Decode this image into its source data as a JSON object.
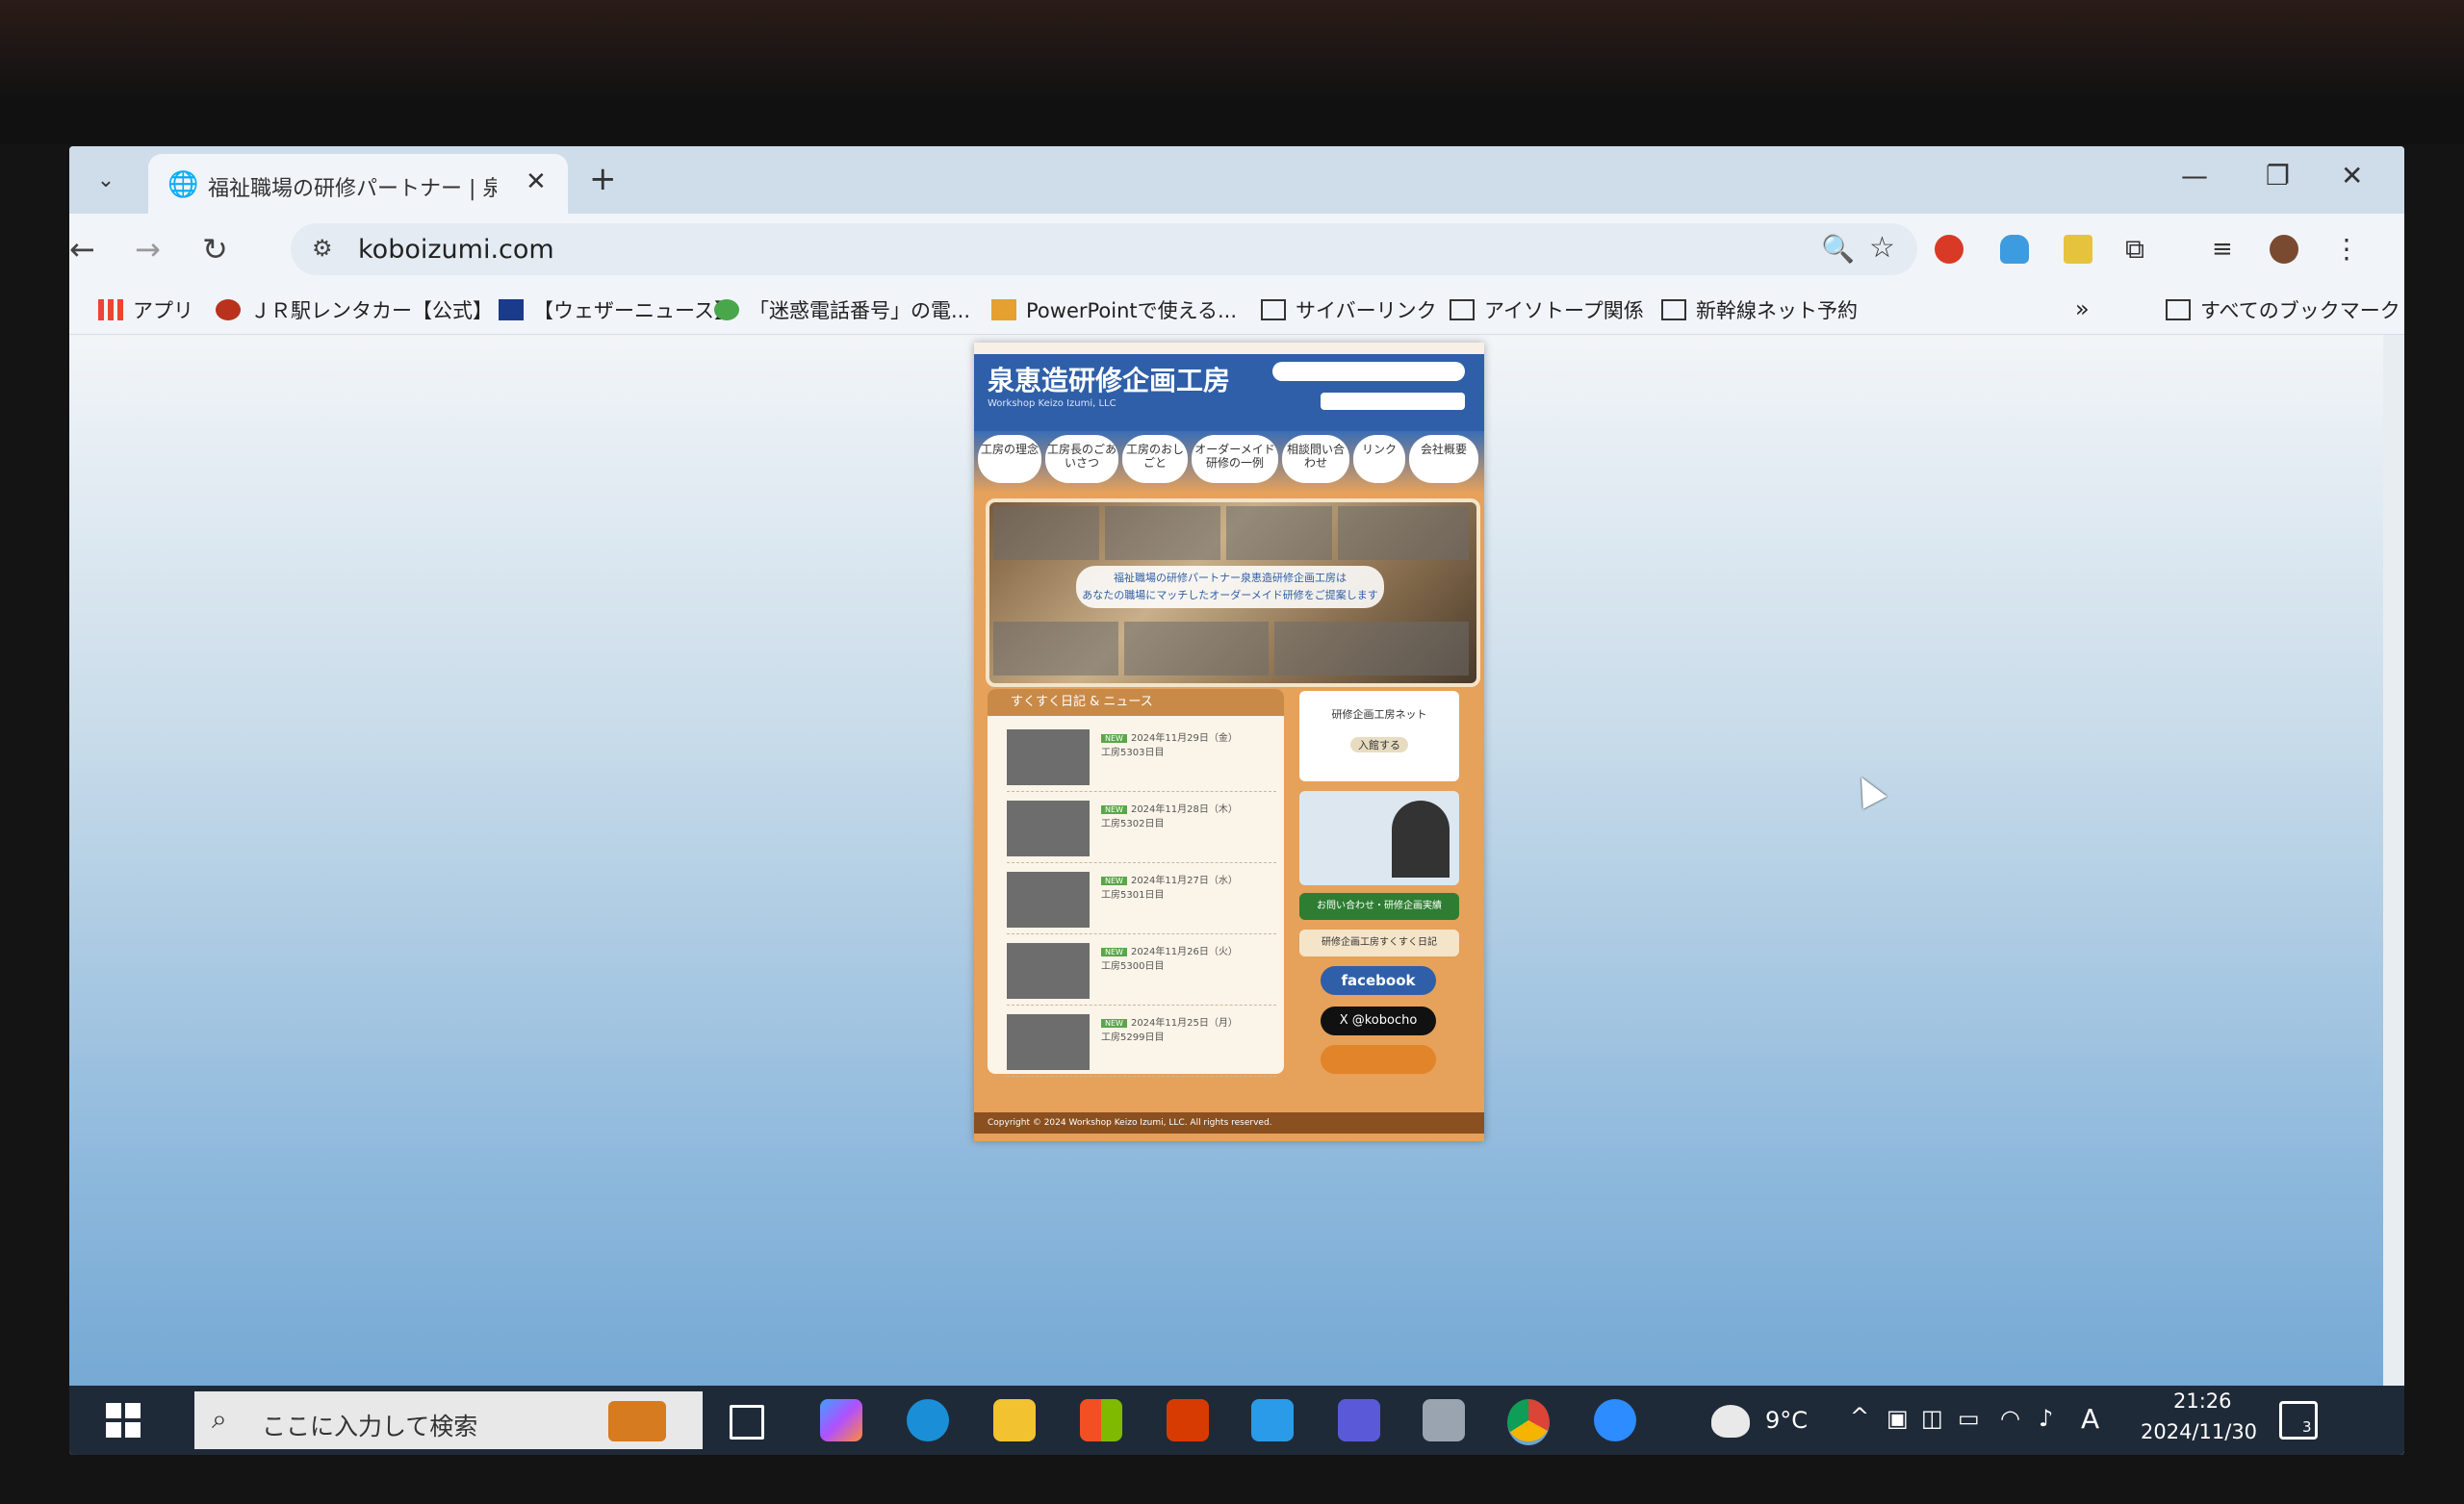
{
  "browser": {
    "tab_title": "福祉職場の研修パートナー | 泉恵",
    "url": "koboizumi.com"
  },
  "bookmarks": [
    {
      "label": "アプリ",
      "icon": "apps-grid-icon"
    },
    {
      "label": "ＪＲ駅レンタカー【公式】",
      "icon": "site-favicon-icon"
    },
    {
      "label": "【ウェザーニュース】",
      "icon": "site-favicon-icon"
    },
    {
      "label": "「迷惑電話番号」の電...",
      "icon": "site-favicon-icon"
    },
    {
      "label": "PowerPointで使える...",
      "icon": "site-favicon-icon"
    },
    {
      "label": "サイバーリンク",
      "icon": "folder-icon"
    },
    {
      "label": "アイソトープ関係",
      "icon": "folder-icon"
    },
    {
      "label": "新幹線ネット予約",
      "icon": "folder-icon"
    }
  ],
  "all_bookmarks": "すべてのブックマーク",
  "website": {
    "logo": "泉恵造研修企画工房",
    "logo_sub": "Workshop Keizo Izumi, LLC",
    "nav": [
      "工房の理念",
      "工房長のごあいさつ",
      "工房のおしごと",
      "オーダーメイド研修の一例",
      "相談問い合わせ",
      "リンク",
      "会社概要"
    ],
    "hero_text_1": "福祉職場の研修パートナー泉恵造研修企画工房は",
    "hero_text_2": "あなたの職場にマッチしたオーダーメイド研修をご提案します",
    "news_title": "すくすく日記 & ニュース",
    "news": [
      {
        "date": "2024年11月29日（金）",
        "text": "工房5303日目"
      },
      {
        "date": "2024年11月28日（木）",
        "text": "工房5302日目"
      },
      {
        "date": "2024年11月27日（水）",
        "text": "工房5301日目"
      },
      {
        "date": "2024年11月26日（火）",
        "text": "工房5300日目"
      },
      {
        "date": "2024年11月25日（月）",
        "text": "工房5299日目"
      }
    ],
    "side_1": "研修企画工房ネット",
    "side_btn": "入館する",
    "side_green": "お問い合わせ・研修企画実績",
    "side_diary": "研修企画工房すくすく日記",
    "facebook": "facebook",
    "x_handle": "X @kobocho",
    "copyright": "Copyright © 2024 Workshop Keizo Izumi, LLC. All rights reserved."
  },
  "taskbar": {
    "search_placeholder": "ここに入力して検索",
    "weather": "9°C",
    "ime": "A",
    "time": "21:26",
    "date": "2024/11/30",
    "notifications": "3"
  }
}
